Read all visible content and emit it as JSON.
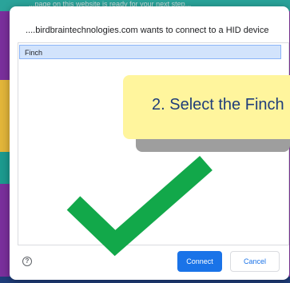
{
  "background": {
    "top_text": "...page on this website is ready for your next step..."
  },
  "dialog": {
    "title": "....birdbraintechnologies.com wants to connect to a HID device",
    "devices": [
      {
        "label": "Finch",
        "selected": true
      }
    ],
    "help_icon": "question-circle-icon",
    "help_glyph": "?",
    "buttons": {
      "connect": "Connect",
      "cancel": "Cancel"
    }
  },
  "annotation": {
    "callout_text": "2. Select the Finch",
    "checkmark_icon": "checkmark-icon"
  },
  "colors": {
    "accent": "#1a73e8",
    "selection": "#d2e3fc",
    "callout": "#fff59d",
    "checkmark": "#12a84a"
  }
}
